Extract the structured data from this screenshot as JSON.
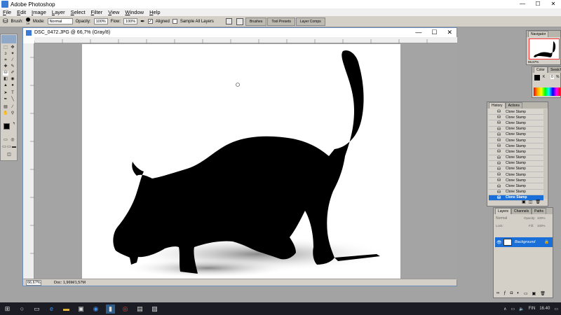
{
  "window": {
    "title": "Adobe Photoshop",
    "minimize": "—",
    "maximize": "☐",
    "close": "✕"
  },
  "menu": [
    {
      "u": "F",
      "rest": "ile"
    },
    {
      "u": "E",
      "rest": "dit"
    },
    {
      "u": "I",
      "rest": "mage"
    },
    {
      "u": "L",
      "rest": "ayer"
    },
    {
      "u": "S",
      "rest": "elect"
    },
    {
      "u": "F",
      "rest": "ilter"
    },
    {
      "u": "V",
      "rest": "iew"
    },
    {
      "u": "W",
      "rest": "indow"
    },
    {
      "u": "H",
      "rest": "elp"
    }
  ],
  "options": {
    "brush_label": "Brush:",
    "brush_size": "19",
    "mode_label": "Mode:",
    "mode_value": "Normal",
    "opacity_label": "Opacity:",
    "opacity_value": "100%",
    "flow_label": "Flow:",
    "flow_value": "100%",
    "aligned_label": "Aligned",
    "sample_label": "Sample All Layers"
  },
  "palette_well": [
    "Brushes",
    "Tool Presets",
    "Layer Comps"
  ],
  "document": {
    "title": "DSC_0472.JPG @ 66,7% (Gray/8)",
    "zoom": "66,67%",
    "doc_info": "Doc: 1,96M/1,57M"
  },
  "navigator": {
    "tab": "Navigator",
    "zoom": "66,67%"
  },
  "color_panel": {
    "tabs": [
      "Color",
      "Swatches"
    ],
    "k_label": "K",
    "k_value": "0",
    "k_unit": "%"
  },
  "history": {
    "tabs": [
      "History",
      "Actions"
    ],
    "item_label": "Clone Stamp",
    "rows": 16,
    "selected_index": 15
  },
  "layers": {
    "tabs": [
      "Layers",
      "Channels",
      "Paths"
    ],
    "blend": "Normal",
    "opacity_label": "Opacity:",
    "opacity_value": "100%",
    "lock_label": "Lock:",
    "fill_label": "Fill:",
    "fill_value": "100%",
    "layer_name": "Background"
  },
  "taskbar": {
    "language": "FIN",
    "time": "16.40"
  },
  "colors": {
    "accent": "#1a6ed8",
    "taskbar": "#1c1c24"
  }
}
